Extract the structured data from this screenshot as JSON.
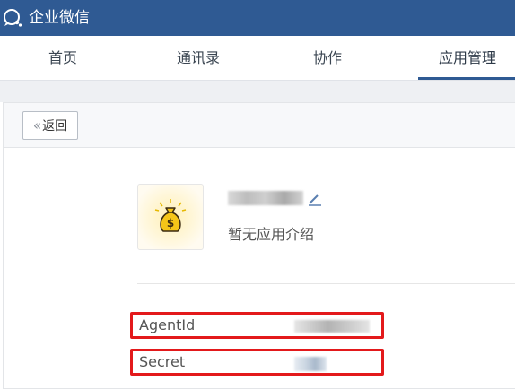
{
  "header": {
    "app_title": "企业微信",
    "logo_icon": "wechat-work-logo-icon",
    "background_color": "#2f5a93"
  },
  "nav": {
    "tabs": [
      {
        "label": "首页",
        "active": false
      },
      {
        "label": "通讯录",
        "active": false
      },
      {
        "label": "协作",
        "active": false
      },
      {
        "label": "应用管理",
        "active": true
      }
    ]
  },
  "toolbar": {
    "back_label": "返回",
    "back_icon": "double-chevron-left-icon"
  },
  "app": {
    "icon": "money-bag-icon",
    "name_redacted": true,
    "description": "暂无应用介绍",
    "edit_icon": "pencil-icon"
  },
  "fields": [
    {
      "label": "AgentId",
      "value_redacted": true
    },
    {
      "label": "Secret",
      "value_redacted": true
    }
  ],
  "highlight_color": "#e3191b"
}
